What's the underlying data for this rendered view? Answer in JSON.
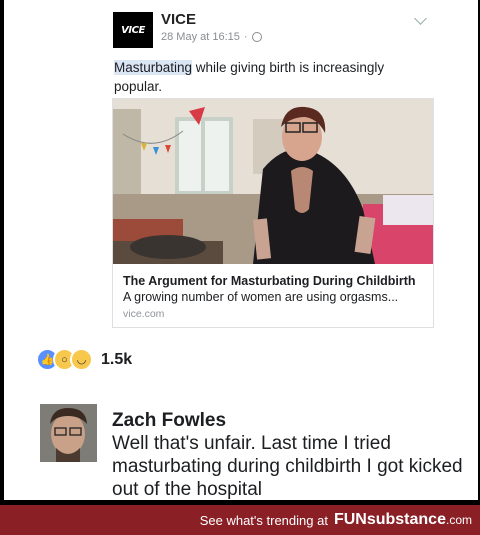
{
  "post": {
    "page_name": "VICE",
    "logo_text": "VICE",
    "timestamp": "28 May at 16:15",
    "separator": "·",
    "text_highlight": "Masturbating",
    "text_rest": " while giving birth is increasingly popular.",
    "link": {
      "title": "The Argument for Masturbating During Childbirth",
      "description": "A growing number of women are using orgasms...",
      "domain": "vice.com"
    },
    "reaction_count": "1.5k"
  },
  "comment": {
    "author": "Zach Fowles",
    "lines": [
      "Well that's unfair. Last time I tried",
      "masturbating during childbirth I got kicked",
      "out of the hospital"
    ]
  },
  "footer": {
    "text": "See what's trending at",
    "brand_bold": "FUNsubstance",
    "brand_domain": ".com"
  },
  "colors": {
    "footer_bg": "#8a2026",
    "like_blue": "#5890ff",
    "reaction_yellow": "#f7c84c"
  },
  "icons": [
    "globe-icon",
    "chevron-down-icon",
    "like-icon",
    "wow-icon",
    "haha-icon"
  ]
}
